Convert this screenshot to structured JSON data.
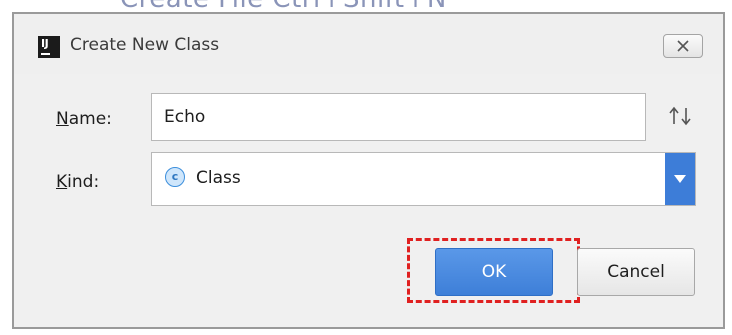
{
  "background_window": {
    "partial_text": "Create File  Ctrl+Shift+N"
  },
  "dialog": {
    "title": "Create New Class",
    "app_icon_text": "IJ",
    "name": {
      "label_mnemonic": "N",
      "label_rest": "ame:",
      "value": "Echo"
    },
    "kind": {
      "label_mnemonic": "K",
      "label_rest": "ind:",
      "icon_letter": "c",
      "value": "Class"
    },
    "buttons": {
      "ok_label": "OK",
      "cancel_label": "Cancel"
    }
  },
  "colors": {
    "accent": "#3d7dd8",
    "highlight": "#e02020"
  }
}
